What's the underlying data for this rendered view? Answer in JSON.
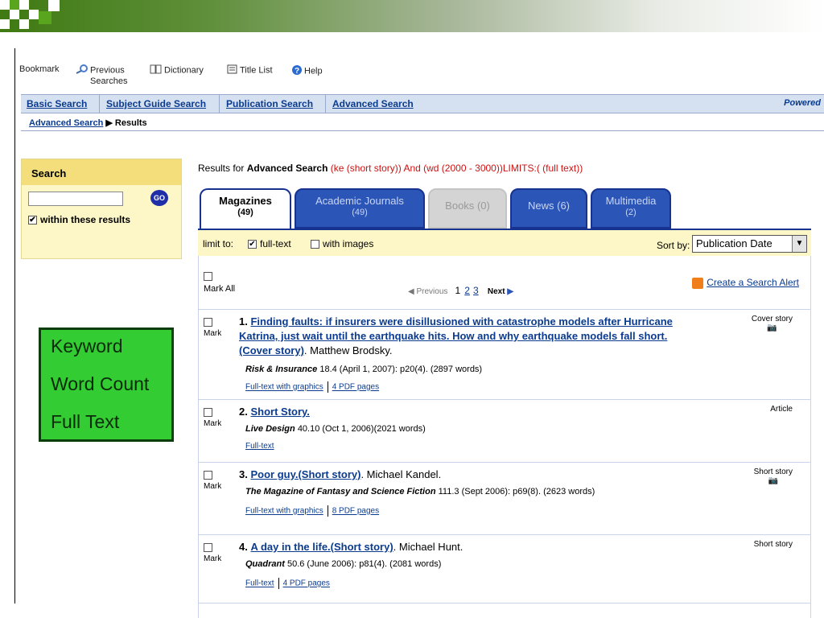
{
  "toolbar": {
    "bookmark": "Bookmark",
    "previous_searches_1": "Previous",
    "previous_searches_2": "Searches",
    "dictionary": "Dictionary",
    "title_list": "Title List",
    "help": "Help"
  },
  "nav": {
    "basic": "Basic Search",
    "subject": "Subject Guide Search",
    "publication": "Publication Search",
    "advanced": "Advanced Search",
    "powered": "Powered"
  },
  "breadcrumb": {
    "link": "Advanced Search",
    "arrow": "▶",
    "current": "Results"
  },
  "sidebar": {
    "header": "Search",
    "go": "GO",
    "within": "within these results",
    "within_checked": "✔"
  },
  "greenbox": {
    "line1": "Keyword",
    "line2": "Word Count",
    "line3": "Full Text"
  },
  "results_header": {
    "prefix": "Results for",
    "type": "Advanced Search",
    "query": "(ke (short story)) And (wd (2000 - 3000))LIMITS:( (full text))"
  },
  "tabs": [
    {
      "label": "Magazines",
      "count": "(49)"
    },
    {
      "label": "Academic Journals",
      "count": "(49)"
    },
    {
      "label": "Books",
      "count": "(0)"
    },
    {
      "label": "News",
      "count": "(6)"
    },
    {
      "label": "Multimedia",
      "count": "(2)"
    }
  ],
  "limit": {
    "label": "limit to:",
    "fulltext": "full-text",
    "fulltext_checked": "✔",
    "images": "with images",
    "sort_label": "Sort by:",
    "sort_value": "Publication Date"
  },
  "list": {
    "mark_all": "Mark All",
    "previous": "Previous",
    "page1": "1",
    "page2": "2",
    "page3": "3",
    "next": "Next",
    "alert": "Create a Search Alert",
    "mark": "Mark"
  },
  "records": [
    {
      "num": "1.",
      "title": "Finding faults: if insurers were disillusioned with catastrophe models after Hurricane Katrina, just wait until the earthquake hits. How and why earthquake models fall short.(Cover story)",
      "author": ". Matthew Brodsky.",
      "journal": "Risk & Insurance",
      "cite": "18.4 (April 1, 2007): p20(4). (2897 words)",
      "link1": "Full-text with graphics",
      "link2": "4 PDF pages",
      "doctype": "Cover story"
    },
    {
      "num": "2.",
      "title": "Short Story.",
      "author": "",
      "journal": "Live Design",
      "cite": "40.10 (Oct 1, 2006)(2021 words)",
      "link1": "Full-text",
      "link2": "",
      "doctype": "Article"
    },
    {
      "num": "3.",
      "title": "Poor guy.(Short story)",
      "author": ". Michael Kandel.",
      "journal": "The Magazine of Fantasy and Science Fiction",
      "cite": "111.3 (Sept 2006): p69(8). (2623 words)",
      "link1": "Full-text with graphics",
      "link2": "8 PDF pages",
      "doctype": "Short story"
    },
    {
      "num": "4.",
      "title": "A day in the life.(Short story)",
      "author": ". Michael Hunt.",
      "journal": "Quadrant",
      "cite": "50.6 (June 2006): p81(4). (2081 words)",
      "link1": "Full-text",
      "link2": "4 PDF pages",
      "doctype": "Short story"
    }
  ]
}
